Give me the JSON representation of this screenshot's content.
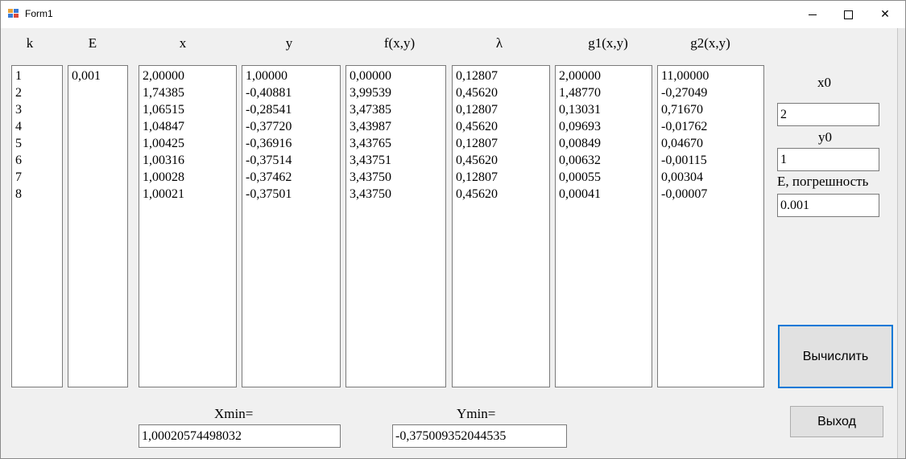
{
  "window": {
    "title": "Form1"
  },
  "columns": {
    "k": {
      "header": "k",
      "values": [
        "1",
        "2",
        "3",
        "4",
        "5",
        "6",
        "7",
        "8"
      ]
    },
    "E": {
      "header": "E",
      "values": [
        "0,001"
      ]
    },
    "x": {
      "header": "x",
      "values": [
        "2,00000",
        "1,74385",
        "1,06515",
        "1,04847",
        "1,00425",
        "1,00316",
        "1,00028",
        "1,00021"
      ]
    },
    "y": {
      "header": "y",
      "values": [
        "1,00000",
        "-0,40881",
        "-0,28541",
        "-0,37720",
        "-0,36916",
        "-0,37514",
        "-0,37462",
        "-0,37501"
      ]
    },
    "f": {
      "header": "f(x,y)",
      "values": [
        "0,00000",
        "3,99539",
        "3,47385",
        "3,43987",
        "3,43765",
        "3,43751",
        "3,43750",
        "3,43750"
      ]
    },
    "lambda": {
      "header": "λ",
      "values": [
        "0,12807",
        "0,45620",
        "0,12807",
        "0,45620",
        "0,12807",
        "0,45620",
        "0,12807",
        "0,45620"
      ]
    },
    "g1": {
      "header": "g1(x,y)",
      "values": [
        "2,00000",
        "1,48770",
        "0,13031",
        "0,09693",
        "0,00849",
        "0,00632",
        "0,00055",
        "0,00041"
      ]
    },
    "g2": {
      "header": "g2(x,y)",
      "values": [
        "11,00000",
        "-0,27049",
        "0,71670",
        "-0,01762",
        "0,04670",
        "-0,00115",
        "0,00304",
        "-0,00007"
      ]
    }
  },
  "inputs": {
    "x0_label": "x0",
    "x0_value": "2",
    "y0_label": "y0",
    "y0_value": "1",
    "eps_label": "E, погрешность",
    "eps_value": "0.001"
  },
  "results": {
    "xmin_label": "Xmin=",
    "xmin_value": "1,00020574498032",
    "ymin_label": "Ymin=",
    "ymin_value": "-0,375009352044535"
  },
  "buttons": {
    "compute": "Вычислить",
    "exit": "Выход"
  }
}
